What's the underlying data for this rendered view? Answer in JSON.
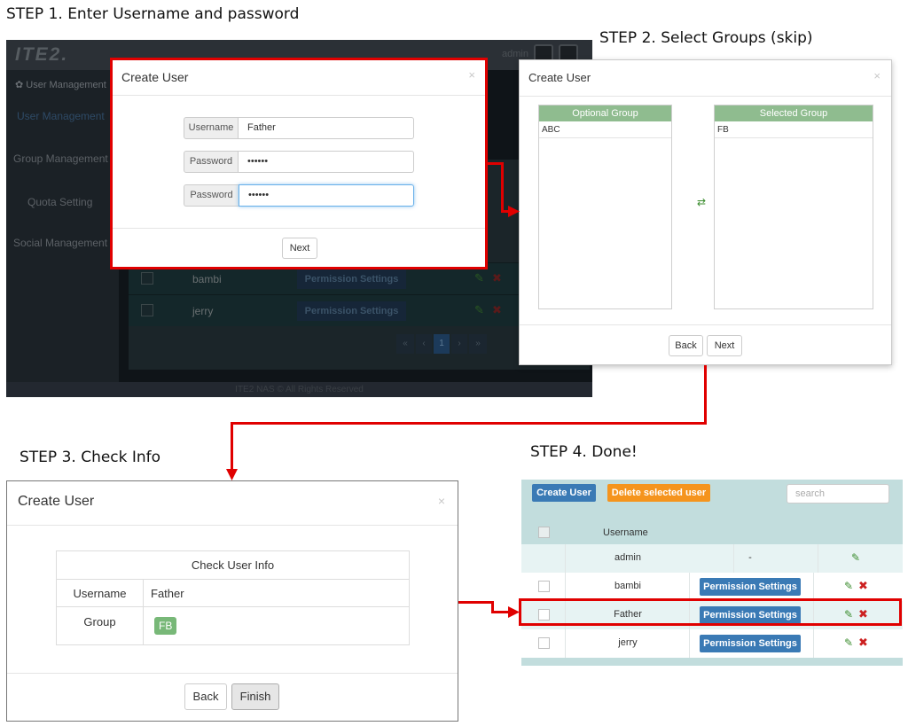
{
  "steps": {
    "step1": "STEP 1. Enter Username and password",
    "step2": "STEP 2. Select Groups (skip)",
    "step3": "STEP 3. Check Info",
    "step4": "STEP 4. Done!"
  },
  "background_app": {
    "logo": "ITE2.",
    "header_user": "admin",
    "sidebar": {
      "header": "User Management",
      "items": [
        "User Management",
        "Group Management",
        "Quota Setting",
        "Social Management"
      ]
    },
    "rows": [
      {
        "username": "bambi",
        "permission_label": "Permission Settings"
      },
      {
        "username": "jerry",
        "permission_label": "Permission Settings"
      }
    ],
    "pager": [
      "«",
      "‹",
      "1",
      "›",
      "»"
    ],
    "footer": "ITE2 NAS © All Rights Reserved"
  },
  "step1_modal": {
    "title": "Create User",
    "close": "×",
    "username_label": "Username",
    "username_value": "Father",
    "password_label": "Password",
    "password_value": "••••••",
    "password_confirm_label": "Password",
    "password_confirm_value": "••••••",
    "next_label": "Next"
  },
  "step2_modal": {
    "title": "Create User",
    "close": "×",
    "optional_header": "Optional Group",
    "optional_items": [
      "ABC"
    ],
    "selected_header": "Selected Group",
    "selected_items": [
      "FB"
    ],
    "swap_icon": "⇄",
    "back_label": "Back",
    "next_label": "Next"
  },
  "step3_modal": {
    "title": "Create User",
    "close": "×",
    "table_title": "Check User Info",
    "username_label": "Username",
    "username_value": "Father",
    "group_label": "Group",
    "group_value": "FB",
    "back_label": "Back",
    "finish_label": "Finish"
  },
  "step4_table": {
    "create_label": "Create User",
    "delete_label": "Delete selected user",
    "search_placeholder": "search",
    "header_username": "Username",
    "rows": [
      {
        "username": "admin",
        "permission": "-"
      },
      {
        "username": "bambi",
        "permission": "Permission Settings"
      },
      {
        "username": "Father",
        "permission": "Permission Settings"
      },
      {
        "username": "jerry",
        "permission": "Permission Settings"
      }
    ]
  },
  "colors": {
    "highlight_red": "#e00000",
    "group_header_green": "#8fbc8f",
    "create_button_blue": "#3a7ab5",
    "delete_button_orange": "#f5941d",
    "table_bg": "#c2dddd"
  }
}
